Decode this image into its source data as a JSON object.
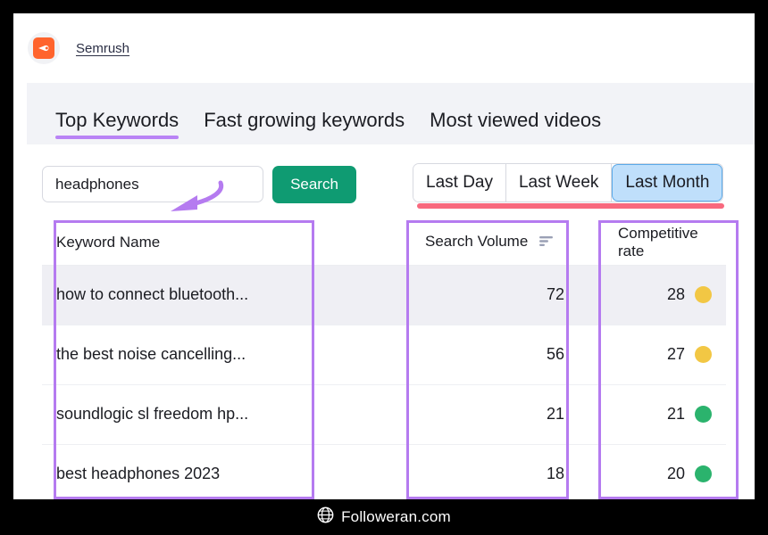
{
  "brand": {
    "name": "Semrush",
    "logo_icon": "semrush-comet-icon",
    "logo_color": "#ff642d"
  },
  "tabs": [
    {
      "label": "Top Keywords",
      "active": true
    },
    {
      "label": "Fast growing keywords",
      "active": false
    },
    {
      "label": "Most viewed videos",
      "active": false
    }
  ],
  "tab_accent_color": "#b983f5",
  "search": {
    "value": "headphones",
    "placeholder": "Enter keyword",
    "button_label": "Search",
    "button_color": "#0f9b72"
  },
  "range_control": {
    "options": [
      "Last Day",
      "Last Week",
      "Last Month"
    ],
    "selected": "Last Month",
    "selected_bg": "#bfdffb",
    "underline_color": "#f8697e"
  },
  "annotation": {
    "arrow_color": "#b57bf0",
    "box_color": "#b57bf0"
  },
  "table": {
    "columns": [
      "Keyword Name",
      "Search Volume",
      "Competitive rate"
    ],
    "sort_icon": "sort-descending-icon",
    "sorted_column": "Search Volume",
    "rows": [
      {
        "keyword": "how to connect bluetooth...",
        "volume": "72",
        "rate": "28",
        "dot_color": "#f2c744"
      },
      {
        "keyword": "the best noise cancelling...",
        "volume": "56",
        "rate": "27",
        "dot_color": "#f2c744"
      },
      {
        "keyword": "soundlogic sl freedom hp...",
        "volume": "21",
        "rate": "21",
        "dot_color": "#2bb36d"
      },
      {
        "keyword": "best headphones 2023",
        "volume": "18",
        "rate": "20",
        "dot_color": "#2bb36d"
      }
    ]
  },
  "footer": {
    "text": "Followeran.com",
    "icon": "globe-icon"
  }
}
